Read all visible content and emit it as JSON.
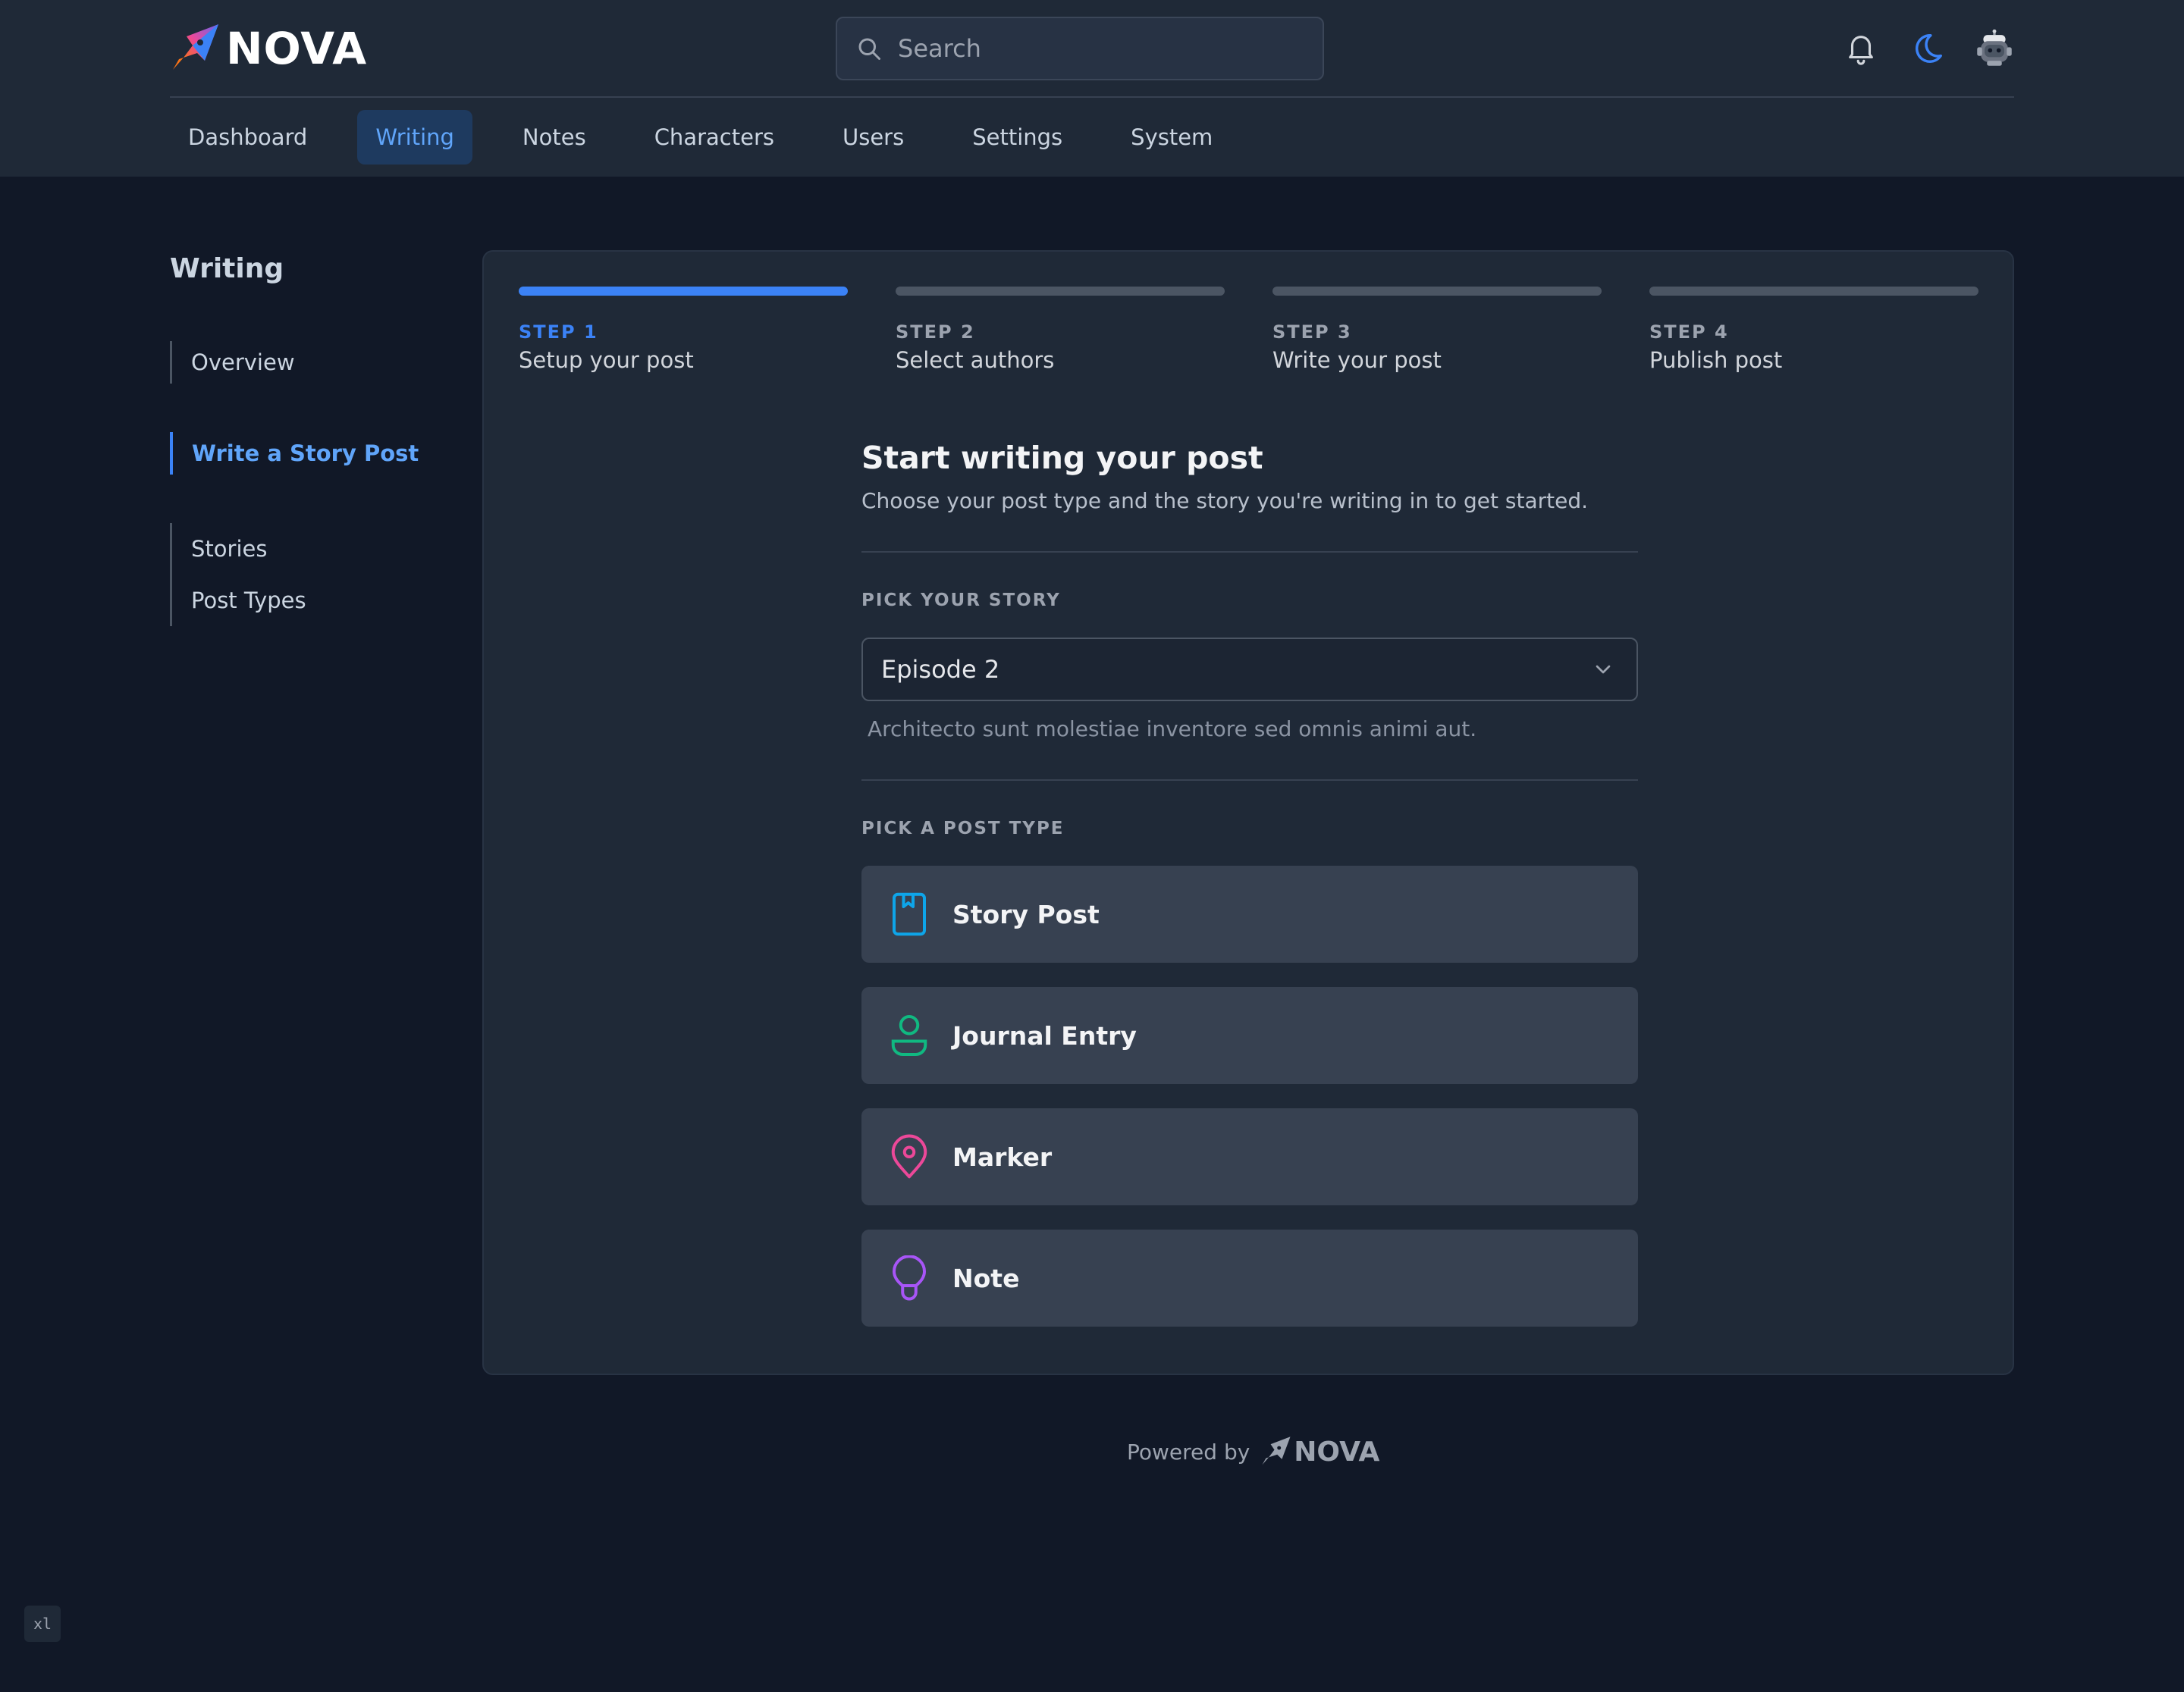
{
  "brand": {
    "name": "NOVA"
  },
  "search": {
    "placeholder": "Search"
  },
  "nav": {
    "tabs": [
      {
        "label": "Dashboard",
        "active": false
      },
      {
        "label": "Writing",
        "active": true
      },
      {
        "label": "Notes",
        "active": false
      },
      {
        "label": "Characters",
        "active": false
      },
      {
        "label": "Users",
        "active": false
      },
      {
        "label": "Settings",
        "active": false
      },
      {
        "label": "System",
        "active": false
      }
    ]
  },
  "sidebar": {
    "title": "Writing",
    "items": [
      {
        "label": "Overview"
      },
      {
        "label": "Write a Story Post",
        "active": true
      },
      {
        "label": "Stories"
      },
      {
        "label": "Post Types"
      }
    ]
  },
  "wizard": {
    "steps": [
      {
        "number": "STEP 1",
        "label": "Setup your post",
        "active": true
      },
      {
        "number": "STEP 2",
        "label": "Select authors",
        "active": false
      },
      {
        "number": "STEP 3",
        "label": "Write your post",
        "active": false
      },
      {
        "number": "STEP 4",
        "label": "Publish post",
        "active": false
      }
    ],
    "current_step": 1,
    "total_steps": 4
  },
  "form": {
    "title": "Start writing your post",
    "description": "Choose your post type and the story you're writing in to get started.",
    "story_label": "PICK YOUR STORY",
    "story_selected": "Episode 2",
    "story_helper": "Architecto sunt molestiae inventore sed omnis animi aut.",
    "post_type_label": "PICK A POST TYPE",
    "post_types": [
      {
        "name": "Story Post",
        "icon": "book-icon",
        "color": "#0ea5e9"
      },
      {
        "name": "Journal Entry",
        "icon": "user-icon",
        "color": "#10b981"
      },
      {
        "name": "Marker",
        "icon": "map-pin-icon",
        "color": "#ec4899"
      },
      {
        "name": "Note",
        "icon": "lightbulb-icon",
        "color": "#a855f7"
      }
    ]
  },
  "footer": {
    "powered_by": "Powered by",
    "brand": "NOVA"
  },
  "breakpoint_badge": "xl",
  "colors": {
    "accent": "#3b82f6",
    "background": "#111827",
    "surface": "#1f2937",
    "card_item": "#374151"
  }
}
